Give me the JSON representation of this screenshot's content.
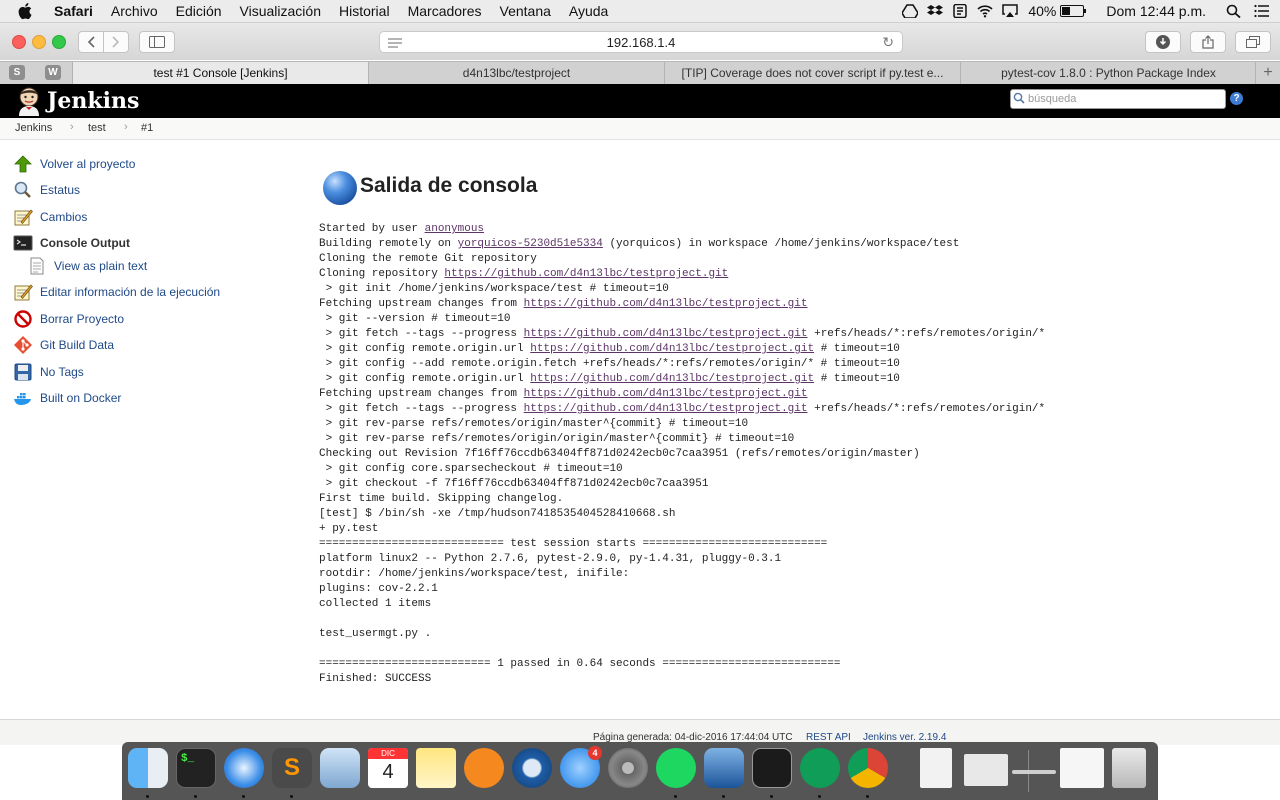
{
  "menubar": {
    "app_name": "Safari",
    "items": [
      "Archivo",
      "Edición",
      "Visualización",
      "Historial",
      "Marcadores",
      "Ventana",
      "Ayuda"
    ],
    "battery": "40%",
    "clock": "Dom 12:44 p.m."
  },
  "browser": {
    "address": "192.168.1.4",
    "pinned_tabs": [
      "S",
      "W"
    ],
    "tabs": [
      {
        "label": "test #1 Console [Jenkins]",
        "active": true
      },
      {
        "label": "d4n13lbc/testproject",
        "active": false
      },
      {
        "label": "[TIP] Coverage does not cover script if py.test e...",
        "active": false
      },
      {
        "label": "pytest-cov 1.8.0 : Python Package Index",
        "active": false
      }
    ],
    "new_tab": "+"
  },
  "jenkins": {
    "title": "Jenkins",
    "search_placeholder": "búsqueda",
    "help": "?"
  },
  "breadcrumbs": [
    "Jenkins",
    "test",
    "#1"
  ],
  "sidebar": {
    "items": [
      {
        "label": "Volver al proyecto",
        "icon": "up-arrow-icon"
      },
      {
        "label": "Estatus",
        "icon": "magnifier-icon"
      },
      {
        "label": "Cambios",
        "icon": "notepad-icon"
      },
      {
        "label": "Console Output",
        "icon": "terminal-icon",
        "current": true
      },
      {
        "label": "View as plain text",
        "icon": "document-icon"
      },
      {
        "label": "Editar información de la ejecución",
        "icon": "notepad-icon"
      },
      {
        "label": "Borrar Proyecto",
        "icon": "no-entry-icon"
      },
      {
        "label": "Git Build Data",
        "icon": "git-icon"
      },
      {
        "label": "No Tags",
        "icon": "save-icon"
      },
      {
        "label": "Built on Docker",
        "icon": "docker-icon"
      }
    ]
  },
  "main": {
    "title": "Salida de consola",
    "console": [
      [
        {
          "t": "Started by user "
        },
        {
          "t": "anonymous",
          "link": true
        }
      ],
      [
        {
          "t": "Building remotely on "
        },
        {
          "t": "yorquicos-5230d51e5334",
          "link": true
        },
        {
          "t": " (yorquicos) in workspace /home/jenkins/workspace/test"
        }
      ],
      [
        {
          "t": "Cloning the remote Git repository"
        }
      ],
      [
        {
          "t": "Cloning repository "
        },
        {
          "t": "https://github.com/d4n13lbc/testproject.git",
          "link": true
        }
      ],
      [
        {
          "t": " > git init /home/jenkins/workspace/test # timeout=10"
        }
      ],
      [
        {
          "t": "Fetching upstream changes from "
        },
        {
          "t": "https://github.com/d4n13lbc/testproject.git",
          "link": true
        }
      ],
      [
        {
          "t": " > git --version # timeout=10"
        }
      ],
      [
        {
          "t": " > git fetch --tags --progress "
        },
        {
          "t": "https://github.com/d4n13lbc/testproject.git",
          "link": true
        },
        {
          "t": " +refs/heads/*:refs/remotes/origin/*"
        }
      ],
      [
        {
          "t": " > git config remote.origin.url "
        },
        {
          "t": "https://github.com/d4n13lbc/testproject.git",
          "link": true
        },
        {
          "t": " # timeout=10"
        }
      ],
      [
        {
          "t": " > git config --add remote.origin.fetch +refs/heads/*:refs/remotes/origin/* # timeout=10"
        }
      ],
      [
        {
          "t": " > git config remote.origin.url "
        },
        {
          "t": "https://github.com/d4n13lbc/testproject.git",
          "link": true
        },
        {
          "t": " # timeout=10"
        }
      ],
      [
        {
          "t": "Fetching upstream changes from "
        },
        {
          "t": "https://github.com/d4n13lbc/testproject.git",
          "link": true
        }
      ],
      [
        {
          "t": " > git fetch --tags --progress "
        },
        {
          "t": "https://github.com/d4n13lbc/testproject.git",
          "link": true
        },
        {
          "t": " +refs/heads/*:refs/remotes/origin/*"
        }
      ],
      [
        {
          "t": " > git rev-parse refs/remotes/origin/master^{commit} # timeout=10"
        }
      ],
      [
        {
          "t": " > git rev-parse refs/remotes/origin/origin/master^{commit} # timeout=10"
        }
      ],
      [
        {
          "t": "Checking out Revision 7f16ff76ccdb63404ff871d0242ecb0c7caa3951 (refs/remotes/origin/master)"
        }
      ],
      [
        {
          "t": " > git config core.sparsecheckout # timeout=10"
        }
      ],
      [
        {
          "t": " > git checkout -f 7f16ff76ccdb63404ff871d0242ecb0c7caa3951"
        }
      ],
      [
        {
          "t": "First time build. Skipping changelog."
        }
      ],
      [
        {
          "t": "[test] $ /bin/sh -xe /tmp/hudson7418535404528410668.sh"
        }
      ],
      [
        {
          "t": "+ py.test"
        }
      ],
      [
        {
          "t": "============================ test session starts ============================"
        }
      ],
      [
        {
          "t": "platform linux2 -- Python 2.7.6, pytest-2.9.0, py-1.4.31, pluggy-0.3.1"
        }
      ],
      [
        {
          "t": "rootdir: /home/jenkins/workspace/test, inifile:"
        }
      ],
      [
        {
          "t": "plugins: cov-2.2.1"
        }
      ],
      [
        {
          "t": "collected 1 items"
        }
      ],
      [
        {
          "t": ""
        }
      ],
      [
        {
          "t": "test_usermgt.py ."
        }
      ],
      [
        {
          "t": ""
        }
      ],
      [
        {
          "t": "========================== 1 passed in 0.64 seconds ==========================="
        }
      ],
      [
        {
          "t": "Finished: SUCCESS"
        }
      ]
    ]
  },
  "footer": {
    "generated": "Página generada: 04-dic-2016 17:44:04 UTC",
    "rest_api": "REST API",
    "version": "Jenkins ver. 2.19.4"
  },
  "dock": {
    "appstore_badge": "4",
    "calendar_month": "DIC",
    "calendar_day": "4",
    "apps": [
      "Finder",
      "Terminal",
      "Safari",
      "Sublime Text",
      "Mail",
      "Calendar",
      "Notes",
      "iBooks",
      "QuickTime Player",
      "App Store",
      "System Preferences",
      "Spotify",
      "VirtualBox",
      "Terminal window",
      "Hangouts",
      "Chrome",
      "PDF document",
      "Window preview",
      "Window preview",
      "Window preview",
      "Trash"
    ]
  }
}
